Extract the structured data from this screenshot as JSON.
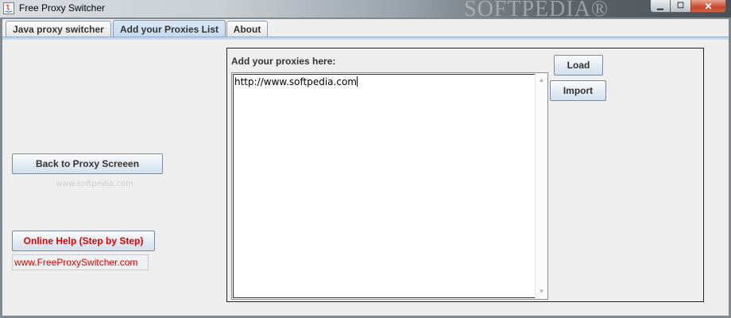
{
  "window": {
    "title": "Free Proxy Switcher",
    "watermark": "SOFTPEDIA®",
    "controls": {
      "minimize_icon": "minimize-icon",
      "maximize_icon": "maximize-icon",
      "close_icon": "close-icon"
    }
  },
  "tabs": [
    {
      "label": "Java proxy switcher",
      "active": false
    },
    {
      "label": "Add your Proxies List",
      "active": true
    },
    {
      "label": "About",
      "active": false
    }
  ],
  "left_panel": {
    "back_button": "Back to Proxy Screeen",
    "watermark_small": "www.softpedia.com",
    "help_button": "Online Help (Step by Step)",
    "website": "www.FreeProxySwitcher.com"
  },
  "proxy_panel": {
    "label": "Add your proxies here:",
    "textarea_value": "http://www.softpedia.com",
    "load_button": "Load",
    "import_button": "Import"
  },
  "colors": {
    "help_text": "#e00000",
    "active_tab": "#c5d9ec"
  }
}
